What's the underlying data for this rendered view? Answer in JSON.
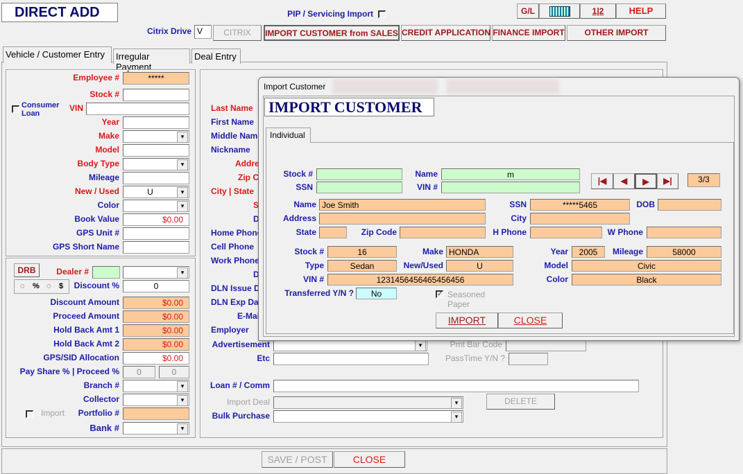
{
  "header": {
    "title": "DIRECT ADD",
    "pip_label": "PIP / Servicing  Import",
    "citrix_drive_label": "Citrix Drive",
    "citrix_drive_value": "V"
  },
  "toolbar": {
    "gl": "G/L",
    "calculator_icon": "calculator-icon",
    "numbering_icon": "1|2",
    "help": "HELP",
    "citrix": "CITRIX",
    "import_sales": "IMPORT CUSTOMER from SALES",
    "credit_app": "CREDIT APPLICATION",
    "finance_import": "FINANCE IMPORT",
    "other_import": "OTHER IMPORT"
  },
  "tabs": [
    "Vehicle / Customer Entry",
    "Irregular Payment",
    "Deal Entry"
  ],
  "vehicle": {
    "employee_label": "Employee #",
    "employee_value": "*****",
    "stock_label": "Stock #",
    "consumer_loan": "Consumer Loan",
    "vin_label": "VIN",
    "year_label": "Year",
    "make_label": "Make",
    "model_label": "Model",
    "body_label": "Body Type",
    "mileage_label": "Mileage",
    "new_used_label": "New / Used",
    "new_used_value": "U",
    "color_label": "Color",
    "book_label": "Book Value",
    "book_value": "$0.00",
    "gps_unit_label": "GPS Unit #",
    "gps_short_label": "GPS Short Name"
  },
  "dealer": {
    "drb": "DRB",
    "dealer_label": "Dealer #",
    "pct": "%",
    "dollar": "$",
    "discount_pct_label": "Discount %",
    "discount_pct_value": "0",
    "discount_amt_label": "Discount Amount",
    "discount_amt": "$0.00",
    "proceed_label": "Proceed Amount",
    "proceed": "$0.00",
    "hb1_label": "Hold Back Amt 1",
    "hb1": "$0.00",
    "hb2_label": "Hold Back Amt 2",
    "hb2": "$0.00",
    "gps_sid_label": "GPS/SID Allocation",
    "gps_sid": "$0.00",
    "pay_share_label": "Pay Share % | Proceed %",
    "pay_share": "0",
    "proceed_pct": "0",
    "branch_label": "Branch #",
    "collector_label": "Collector",
    "import_label": "Import",
    "portfolio_label": "Portfolio #",
    "bank_label": "Bank #"
  },
  "customer": {
    "labels": [
      "Last Name",
      "First Name",
      "Middle Name",
      "Nickname",
      "Address",
      "Zip Code",
      "City | State",
      "SSN",
      "DOB",
      "Home Phone",
      "Cell Phone",
      "Work Phone",
      "DL #",
      "DLN Issue Date",
      "DLN Exp Date",
      "E-Mail",
      "Employer"
    ],
    "advertisement_label": "Advertisement",
    "etc_label": "Etc",
    "pmt_bar_label": "Pmt Bar Code",
    "passtime_label": "PassTime Y/N ?",
    "loan_label": "Loan # / Comm",
    "import_deal_label": "Import Deal",
    "delete": "DELETE",
    "bulk_label": "Bulk Purchase"
  },
  "footer": {
    "save": "SAVE / POST",
    "close": "CLOSE"
  },
  "dialog": {
    "window_title": "Import Customer",
    "heading": "IMPORT CUSTOMER",
    "tab": "Individual",
    "search": {
      "stock_label": "Stock #",
      "name_label": "Name",
      "name_value": "m",
      "ssn_label": "SSN",
      "vin_label": "VIN #"
    },
    "record_position": "3/3",
    "person": {
      "name_label": "Name",
      "name": "Joe Smith",
      "ssn_label": "SSN",
      "ssn": "*****5465",
      "dob_label": "DOB",
      "address_label": "Address",
      "city_label": "City",
      "state_label": "State",
      "zip_label": "Zip Code",
      "hphone_label": "H Phone",
      "wphone_label": "W Phone"
    },
    "vehicle": {
      "stock_label": "Stock #",
      "stock": "16",
      "make_label": "Make",
      "make": "HONDA",
      "year_label": "Year",
      "year": "2005",
      "mileage_label": "Mileage",
      "mileage": "58000",
      "type_label": "Type",
      "type": "Sedan",
      "new_used_label": "New/Used",
      "new_used": "U",
      "model_label": "Model",
      "model": "Civic",
      "vin_label": "VIN #",
      "vin": "1231456456465456456",
      "color_label": "Color",
      "color": "Black",
      "transferred_label": "Transferred Y/N ?",
      "transferred": "No",
      "seasoned_label": "Seasoned Paper",
      "seasoned_checked": true
    },
    "import": "IMPORT",
    "close": "CLOSE"
  },
  "colors": {
    "label_blue": "#1c1ca8",
    "label_red": "#d81818",
    "field_orange": "#fccb9c",
    "field_green": "#ccfccc",
    "title_navy": "#0c0c6c"
  }
}
